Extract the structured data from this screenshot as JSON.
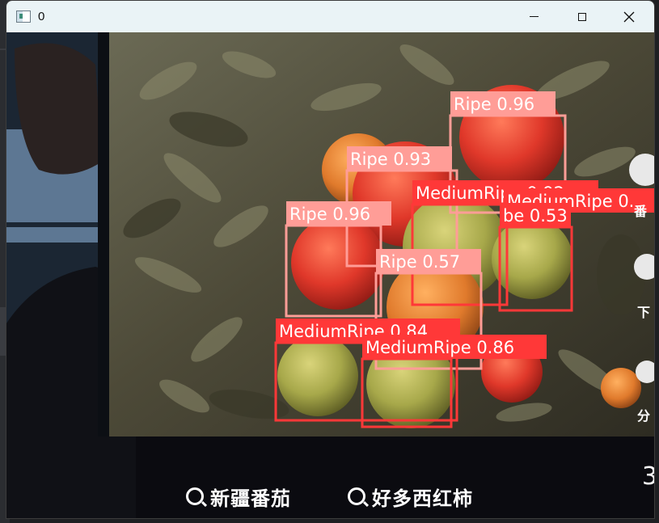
{
  "window": {
    "title": "0",
    "controls": {
      "minimize": "minimize",
      "maximize": "maximize",
      "close": "close"
    }
  },
  "detections": [
    {
      "label": "Ripe 0.96",
      "class": "Ripe",
      "score": 0.96,
      "color": "#ff9d97"
    },
    {
      "label": "Ripe 0.93",
      "class": "Ripe",
      "score": 0.93,
      "color": "#ff9d97"
    },
    {
      "label": "MediumRipe 0.92",
      "class": "MediumRipe",
      "score": 0.92,
      "color": "#ff3838"
    },
    {
      "label": "MediumRipe 0.",
      "class": "MediumRipe",
      "score": null,
      "color": "#ff3838"
    },
    {
      "label": "Ripe 0.96",
      "class": "Ripe",
      "score": 0.96,
      "color": "#ff9d97"
    },
    {
      "label": "Ripe 0.57",
      "class": "Ripe",
      "score": 0.57,
      "color": "#ff9d97"
    },
    {
      "label": "be 0.53",
      "class": "MediumRipe",
      "score": 0.53,
      "color": "#ff3838"
    },
    {
      "label": "MediumRipe 0.84",
      "class": "MediumRipe",
      "score": 0.84,
      "color": "#ff3838"
    },
    {
      "label": "MediumRipe 0.86",
      "class": "MediumRipe",
      "score": 0.86,
      "color": "#ff3838"
    }
  ],
  "captions": {
    "left": "新疆番茄",
    "right": "好多西红柿"
  },
  "side_glyphs": [
    "番",
    "下",
    "分"
  ]
}
